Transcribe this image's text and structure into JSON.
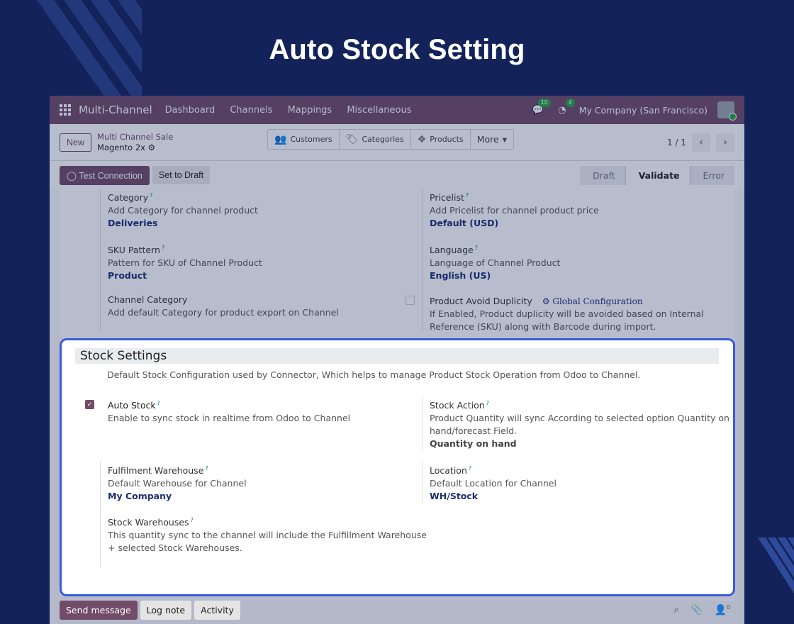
{
  "hero_title": "Auto Stock Setting",
  "navbar": {
    "app_name": "Multi-Channel",
    "menu": [
      "Dashboard",
      "Channels",
      "Mappings",
      "Miscellaneous"
    ],
    "messages_count": "10",
    "activities_count": "4",
    "company": "My Company (San Francisco)"
  },
  "control": {
    "new_label": "New",
    "breadcrumb_parent": "Multi Channel Sale",
    "breadcrumb_current": "Magento 2x",
    "smart_buttons": [
      "Customers",
      "Categories",
      "Products",
      "More"
    ],
    "pager": "1 / 1"
  },
  "status": {
    "test_connection": "Test Connection",
    "set_to_draft": "Set to Draft",
    "stages": [
      "Draft",
      "Validate",
      "Error"
    ]
  },
  "form": {
    "category": {
      "label": "Category",
      "help": "Add Category for channel product",
      "value": "Deliveries"
    },
    "pricelist": {
      "label": "Pricelist",
      "help": "Add Pricelist for channel product price",
      "value": "Default (USD)"
    },
    "sku_pattern": {
      "label": "SKU Pattern",
      "help": "Pattern for SKU of Channel Product",
      "value": "Product"
    },
    "language": {
      "label": "Language",
      "help": "Language of Channel Product",
      "value": "English (US)"
    },
    "channel_category": {
      "label": "Channel Category",
      "help": "Add default Category for product export on Channel"
    },
    "avoid_duplicity": {
      "label": "Product Avoid Duplicity",
      "link": "Global Configuration",
      "help1": "If Enabled, Product duplicity will be avoided based on Internal",
      "help2": "Reference (SKU) along with Barcode during import."
    }
  },
  "stock": {
    "title": "Stock Settings",
    "description": "Default Stock Configuration used by Connector, Which helps to manage Product Stock Operation from Odoo to Channel.",
    "auto_stock": {
      "label": "Auto Stock",
      "help": "Enable to sync stock in realtime from Odoo to Channel",
      "checked": true
    },
    "stock_action": {
      "label": "Stock Action",
      "help1": "Product Quantity will sync According to selected option Quantity on",
      "help2": "hand/forecast Field.",
      "value": "Quantity on hand"
    },
    "fulfilment": {
      "label": "Fulfilment Warehouse",
      "help": "Default Warehouse for Channel",
      "value": "My Company"
    },
    "location": {
      "label": "Location",
      "help": "Default Location for Channel",
      "value": "WH/Stock"
    },
    "warehouses": {
      "label": "Stock Warehouses",
      "help1": "This quantity sync to the channel will include the Fulfillment Warehouse",
      "help2": "+ selected Stock Warehouses."
    }
  },
  "chatter": {
    "send_message": "Send message",
    "log_note": "Log note",
    "activity": "Activity",
    "followers_count": "0"
  }
}
